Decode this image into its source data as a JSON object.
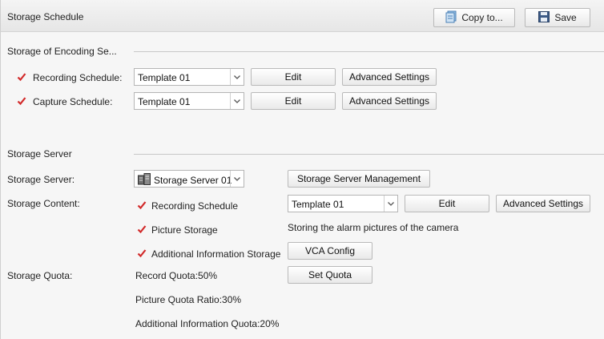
{
  "header": {
    "title": "Storage Schedule",
    "copy_label": "Copy to...",
    "save_label": "Save"
  },
  "encoding": {
    "section_title": "Storage of Encoding Se...",
    "rows": [
      {
        "label": "Recording Schedule:",
        "template": "Template 01",
        "edit": "Edit",
        "advanced": "Advanced Settings",
        "checked": true
      },
      {
        "label": "Capture Schedule:",
        "template": "Template 01",
        "edit": "Edit",
        "advanced": "Advanced Settings",
        "checked": true
      }
    ]
  },
  "server": {
    "section_title": "Storage Server",
    "server_label": "Storage Server:",
    "server_value": "Storage Server 01",
    "management_label": "Storage Server Management",
    "content_label": "Storage Content:",
    "recording_schedule": {
      "label": "Recording Schedule",
      "template": "Template 01",
      "edit": "Edit",
      "advanced": "Advanced Settings",
      "checked": true
    },
    "picture_storage": {
      "label": "Picture Storage",
      "note": "Storing the alarm pictures of the camera",
      "checked": true
    },
    "additional_info": {
      "label": "Additional Information Storage",
      "vca": "VCA Config",
      "checked": true
    },
    "quota_label": "Storage Quota:",
    "record_quota": "Record Quota:50%",
    "set_quota": "Set Quota",
    "picture_quota": "Picture Quota Ratio:30%",
    "additional_quota": "Additional Information Quota:20%"
  },
  "colors": {
    "check": "#d22a2a",
    "background": "#f6f6f6"
  }
}
